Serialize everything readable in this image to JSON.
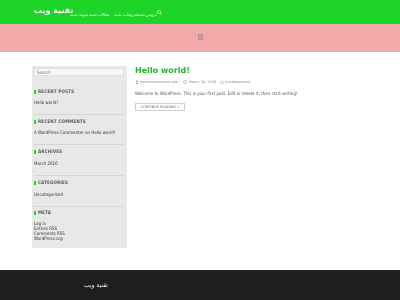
{
  "header": {
    "site_title": "تقنية ويب",
    "nav": [
      {
        "label": "مدونة تقنية"
      },
      {
        "label": "مقالات تقنية"
      },
      {
        "label": "شروحات تقنية"
      },
      {
        "label": "دروس تقنية"
      }
    ]
  },
  "sidebar": {
    "search_placeholder": "Search",
    "recent_posts": {
      "title": "RECENT POSTS",
      "items": [
        "Hello world!"
      ]
    },
    "recent_comments": {
      "title": "RECENT COMMENTS",
      "commenter": "A WordPress Commenter",
      "on": "on",
      "post": "Hello world!"
    },
    "archives": {
      "title": "ARCHIVES",
      "items": [
        "March 2016"
      ]
    },
    "categories": {
      "title": "CATEGORIES",
      "items": [
        "Uncategorized"
      ]
    },
    "meta": {
      "title": "META",
      "items": [
        "Log in",
        "Entries RSS",
        "Comments RSS",
        "WordPress.org"
      ]
    }
  },
  "post": {
    "title": "Hello world!",
    "author": "motortvstreamsz.com",
    "date": "March 28, 2016",
    "category": "Uncategorized",
    "excerpt": "Welcome to WordPress. This is your first post. Edit or delete it, then start writing!",
    "continue_label": "CONTINUE READING »"
  },
  "footer": {
    "site_title": "تقنية ويب"
  },
  "colors": {
    "accent": "#1fd428",
    "hero": "#f2a9a9",
    "footer": "#1f1f1f"
  }
}
